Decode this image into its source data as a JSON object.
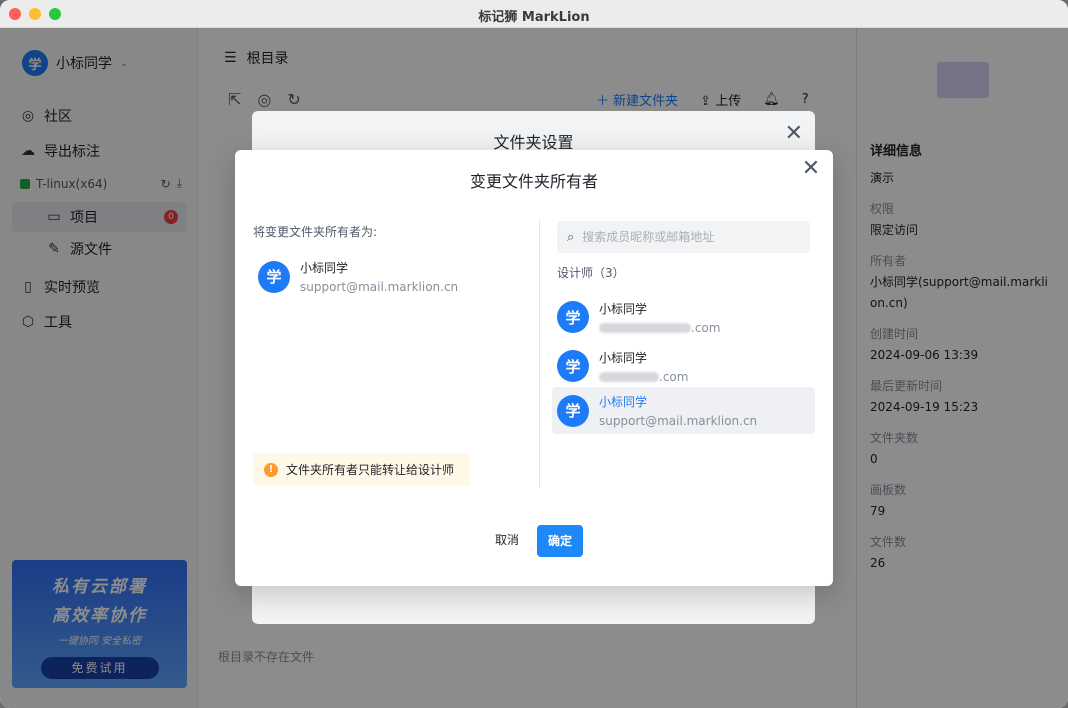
{
  "window": {
    "title": "标记狮 MarkLion"
  },
  "sidebar": {
    "user_name": "小标同学",
    "avatar_char": "学",
    "nav": [
      {
        "label": "社区",
        "icon": "globe-icon"
      },
      {
        "label": "导出标注",
        "icon": "cloud-upload-icon"
      }
    ],
    "project": {
      "name": "T-linux(x64)",
      "badge": "0"
    },
    "sub_items": [
      {
        "label": "项目",
        "icon": "folder-icon"
      },
      {
        "label": "源文件",
        "icon": "pen-icon"
      }
    ],
    "nav2": [
      {
        "label": "实时预览",
        "icon": "phone-icon"
      },
      {
        "label": "工具",
        "icon": "cube-icon"
      }
    ],
    "promo": {
      "line1": "私有云部署",
      "line2": "高效率协作",
      "line3": "一键协同 安全私密",
      "button": "免费试用"
    }
  },
  "main": {
    "breadcrumb": "根目录",
    "new_folder": "新建文件夹",
    "upload": "上传",
    "empty_text": "根目录不存在文件"
  },
  "right_pane": {
    "title": "详细信息",
    "name": "演示",
    "permission_label": "权限",
    "permission_value": "限定访问",
    "owner_label": "所有者",
    "owner_value": "小标同学(support@mail.marklion.cn)",
    "created_label": "创建时间",
    "created_value": "2024-09-06 13:39",
    "updated_label": "最后更新时间",
    "updated_value": "2024-09-19 15:23",
    "folders_label": "文件夹数",
    "folders_value": "0",
    "boards_label": "画板数",
    "boards_value": "79",
    "files_label": "文件数",
    "files_value": "26"
  },
  "back_dialog": {
    "title": "文件夹设置"
  },
  "dialog": {
    "title": "变更文件夹所有者",
    "left_label": "将变更文件夹所有者为:",
    "current": {
      "name": "小标同学",
      "email": "support@mail.marklion.cn"
    },
    "search_placeholder": "搜索成员昵称或邮箱地址",
    "group_label": "设计师（3）",
    "members": [
      {
        "name": "小标同学",
        "email_suffix": ".com",
        "selected": false
      },
      {
        "name": "小标同学",
        "email_suffix": ".com",
        "selected": false
      },
      {
        "name": "小标同学",
        "email": "support@mail.marklion.cn",
        "selected": true
      }
    ],
    "warning": "文件夹所有者只能转让给设计师",
    "cancel": "取消",
    "ok": "确定"
  }
}
